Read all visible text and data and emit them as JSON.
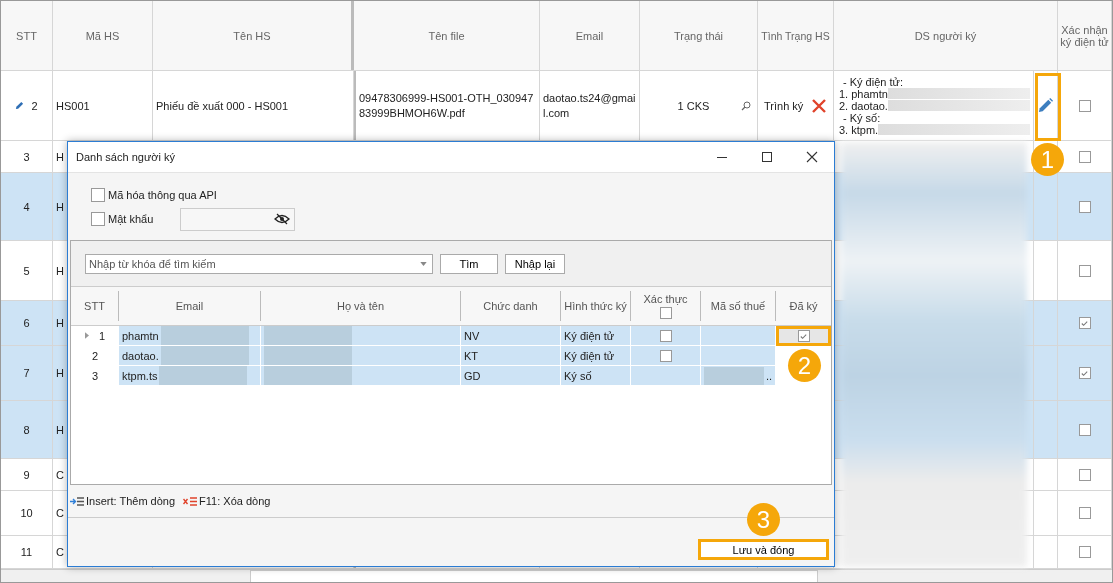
{
  "table": {
    "columns": [
      "STT",
      "Mã HS",
      "Tên HS",
      "Tên file",
      "Email",
      "Trạng thái",
      "Tình Trạng HS",
      "DS người ký",
      "Xác nhận ký điện tử"
    ],
    "rows": [
      {
        "stt": "2",
        "focused": true,
        "selected": false,
        "confirmed": false,
        "ma_hs": "HS001",
        "ten_hs": "Phiếu đề xuất 000 - HS001",
        "ten_file": "09478306999-HS001-OTH_03094783999BHMOH6W.pdf",
        "email": "daotao.ts24@gmail.com",
        "trang_thai": "1 CKS",
        "tinh_trang": "Trình ký",
        "signers": [
          {
            "text": "- Ký điện tử:",
            "redacted": false
          },
          {
            "text": "1. phamtn",
            "redacted": true
          },
          {
            "text": "2. daotao.",
            "redacted": true
          },
          {
            "text": "- Ký số:",
            "redacted": false
          },
          {
            "text": "3. ktpm.",
            "redacted": true
          }
        ]
      },
      {
        "stt": "3",
        "focused": false,
        "selected": false,
        "confirmed": false,
        "ma_hs": "H"
      },
      {
        "stt": "4",
        "focused": false,
        "selected": true,
        "confirmed": false,
        "ma_hs": "H"
      },
      {
        "stt": "5",
        "focused": false,
        "selected": false,
        "confirmed": false,
        "ma_hs": "H"
      },
      {
        "stt": "6",
        "focused": false,
        "selected": true,
        "confirmed": true,
        "ma_hs": "H"
      },
      {
        "stt": "7",
        "focused": false,
        "selected": true,
        "confirmed": true,
        "ma_hs": "H"
      },
      {
        "stt": "8",
        "focused": false,
        "selected": true,
        "confirmed": false,
        "ma_hs": "H"
      },
      {
        "stt": "9",
        "focused": false,
        "selected": false,
        "confirmed": false,
        "ma_hs": "C"
      },
      {
        "stt": "10",
        "focused": false,
        "selected": false,
        "confirmed": false,
        "ma_hs": "C"
      },
      {
        "stt": "11",
        "focused": false,
        "selected": false,
        "confirmed": false,
        "ma_hs": "C"
      }
    ]
  },
  "dialog": {
    "title": "Danh sách người ký",
    "options": [
      {
        "label": "Mã hóa thông qua API",
        "checked": false
      },
      {
        "label": "Mật khẩu",
        "checked": false
      }
    ],
    "search": {
      "placeholder": "Nhập từ khóa để tìm kiếm"
    },
    "buttons": [
      "Tìm",
      "Nhập lại"
    ],
    "columns": [
      "STT",
      "Email",
      "Họ và tên",
      "Chức danh",
      "Hình thức ký",
      "Xác thực",
      "Mã số thuế",
      "Đã ký"
    ],
    "verify_all": false,
    "rows": [
      {
        "stt": "1",
        "current": true,
        "email": "phamtn",
        "title": "NV",
        "method": "Ký điện tử",
        "verified": false,
        "signed": true
      },
      {
        "stt": "2",
        "current": false,
        "email": "daotao.",
        "title": "KT",
        "method": "Ký điện tử",
        "verified": false,
        "signed": false
      },
      {
        "stt": "3",
        "current": false,
        "email": "ktpm.ts",
        "title": "GD",
        "method": "Ký số",
        "tax_id": "..",
        "signed": false
      }
    ],
    "shortcuts": [
      {
        "kind": "add",
        "text": "Insert: Thêm dòng"
      },
      {
        "kind": "delete",
        "text": "F11: Xóa dòng"
      }
    ],
    "save_button": "Lưu và đóng"
  },
  "markers": [
    "1",
    "2",
    "3"
  ]
}
